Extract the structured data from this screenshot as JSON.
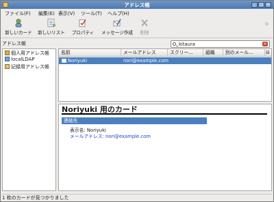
{
  "window": {
    "title": "アドレス帳"
  },
  "menu": [
    "ファイル(F)",
    "編集(E)",
    "表示(V)",
    "ツール(T)",
    "ヘルプ(H)"
  ],
  "toolbar": {
    "new_card": "新しいカード",
    "new_list": "新しいリスト",
    "properties": "プロパティ",
    "compose": "メッセージ作成",
    "delete": "削除"
  },
  "sidebar": {
    "header": "アドレス帳",
    "books": [
      "個人用アドレス帳",
      "localLDAP",
      "記録用アドレス帳"
    ]
  },
  "search": {
    "value": "kitaura"
  },
  "table": {
    "columns": [
      "名前",
      "メールアドレス",
      "スクリー...",
      "組織",
      "別のメール..."
    ],
    "rows": [
      {
        "name": "Noriyuki",
        "email": "nori@example.com",
        "screen": "",
        "org": "",
        "alt": ""
      }
    ]
  },
  "card": {
    "title": "Noriyuki 用のカード",
    "section": "連絡先",
    "display_name": "表示名: Noriyuki",
    "email": "メールアドレス: nori@example.com"
  },
  "status": {
    "text": "1 枚のカードが見つかりました"
  },
  "colors": {
    "selection": "#4a7fc0",
    "link": "#1a3fc9",
    "titlebar": "#5a84ba"
  },
  "icons": [
    "new-card-icon",
    "new-list-icon",
    "properties-icon",
    "compose-icon",
    "delete-icon",
    "search-icon",
    "clear-icon"
  ]
}
